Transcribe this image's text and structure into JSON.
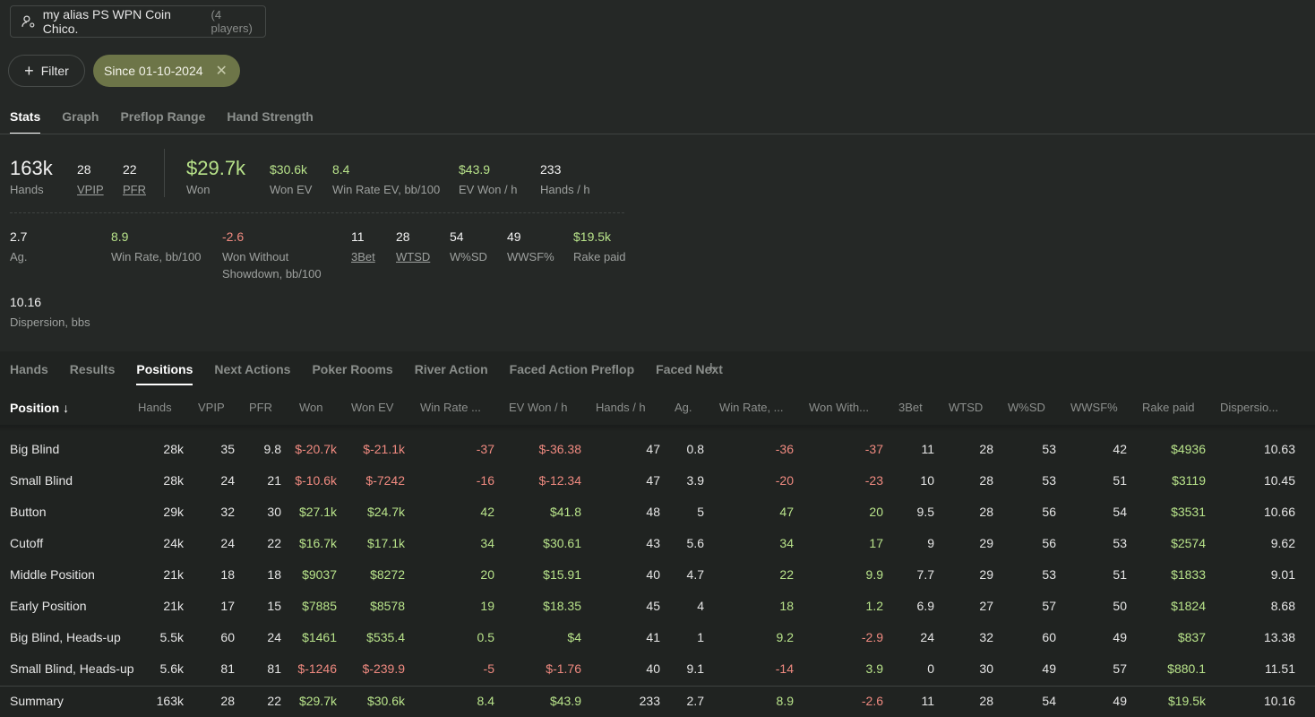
{
  "player": {
    "alias": "my alias PS WPN Coin Chico.",
    "count": "(4 players)"
  },
  "filter": {
    "label": "Filter",
    "since": "Since 01-10-2024"
  },
  "main_tabs": [
    "Stats",
    "Graph",
    "Preflop Range",
    "Hand Strength"
  ],
  "stats": {
    "hands": {
      "value": "163k",
      "label": "Hands"
    },
    "vpip": {
      "value": "28",
      "label": "VPIP"
    },
    "pfr": {
      "value": "22",
      "label": "PFR"
    },
    "won": {
      "value": "$29.7k",
      "label": "Won"
    },
    "won_ev": {
      "value": "$30.6k",
      "label": "Won EV"
    },
    "win_rate_ev": {
      "value": "8.4",
      "label": "Win Rate EV, bb/100"
    },
    "ev_won_h": {
      "value": "$43.9",
      "label": "EV Won / h"
    },
    "hands_h": {
      "value": "233",
      "label": "Hands / h"
    },
    "ag": {
      "value": "2.7",
      "label": "Ag."
    },
    "win_rate": {
      "value": "8.9",
      "label": "Win Rate, bb/100"
    },
    "wwsd": {
      "value": "-2.6",
      "label1": "Won Without",
      "label2": "Showdown, bb/100"
    },
    "threebet": {
      "value": "11",
      "label": "3Bet"
    },
    "wtsd": {
      "value": "28",
      "label": "WTSD"
    },
    "wsd": {
      "value": "54",
      "label": "W%SD"
    },
    "wwsf": {
      "value": "49",
      "label": "WWSF%"
    },
    "rake": {
      "value": "$19.5k",
      "label": "Rake paid"
    },
    "dispersion": {
      "value": "10.16",
      "label": "Dispersion, bbs"
    }
  },
  "sub_tabs": [
    "Hands",
    "Results",
    "Positions",
    "Next Actions",
    "Poker Rooms",
    "River Action",
    "Faced Action Preflop",
    "Faced Next"
  ],
  "table": {
    "headers": [
      "Position ↓",
      "Hands",
      "VPIP",
      "PFR",
      "Won",
      "Won EV",
      "Win Rate ...",
      "EV Won / h",
      "Hands / h",
      "Ag.",
      "Win Rate, ...",
      "Won With...",
      "3Bet",
      "WTSD",
      "W%SD",
      "WWSF%",
      "Rake paid",
      "Dispersio..."
    ],
    "rows": [
      [
        "Big Blind",
        "28k",
        "35",
        "9.8",
        "$-20.7k",
        "$-21.1k",
        "-37",
        "$-36.38",
        "47",
        "0.8",
        "-36",
        "-37",
        "11",
        "28",
        "53",
        "42",
        "$4936",
        "10.63"
      ],
      [
        "Small Blind",
        "28k",
        "24",
        "21",
        "$-10.6k",
        "$-7242",
        "-16",
        "$-12.34",
        "47",
        "3.9",
        "-20",
        "-23",
        "10",
        "28",
        "53",
        "51",
        "$3119",
        "10.45"
      ],
      [
        "Button",
        "29k",
        "32",
        "30",
        "$27.1k",
        "$24.7k",
        "42",
        "$41.8",
        "48",
        "5",
        "47",
        "20",
        "9.5",
        "28",
        "56",
        "54",
        "$3531",
        "10.66"
      ],
      [
        "Cutoff",
        "24k",
        "24",
        "22",
        "$16.7k",
        "$17.1k",
        "34",
        "$30.61",
        "43",
        "5.6",
        "34",
        "17",
        "9",
        "29",
        "56",
        "53",
        "$2574",
        "9.62"
      ],
      [
        "Middle Position",
        "21k",
        "18",
        "18",
        "$9037",
        "$8272",
        "20",
        "$15.91",
        "40",
        "4.7",
        "22",
        "9.9",
        "7.7",
        "29",
        "53",
        "51",
        "$1833",
        "9.01"
      ],
      [
        "Early Position",
        "21k",
        "17",
        "15",
        "$7885",
        "$8578",
        "19",
        "$18.35",
        "45",
        "4",
        "18",
        "1.2",
        "6.9",
        "27",
        "57",
        "50",
        "$1824",
        "8.68"
      ],
      [
        "Big Blind, Heads-up",
        "5.5k",
        "60",
        "24",
        "$1461",
        "$535.4",
        "0.5",
        "$4",
        "41",
        "1",
        "9.2",
        "-2.9",
        "24",
        "32",
        "60",
        "49",
        "$837",
        "13.38"
      ],
      [
        "Small Blind, Heads-up",
        "5.6k",
        "81",
        "81",
        "$-1246",
        "$-239.9",
        "-5",
        "$-1.76",
        "40",
        "9.1",
        "-14",
        "3.9",
        "0",
        "30",
        "49",
        "57",
        "$880.1",
        "11.51"
      ]
    ],
    "summary": [
      "Summary",
      "163k",
      "28",
      "22",
      "$29.7k",
      "$30.6k",
      "8.4",
      "$43.9",
      "233",
      "2.7",
      "8.9",
      "-2.6",
      "11",
      "28",
      "54",
      "49",
      "$19.5k",
      "10.16"
    ]
  },
  "colors": {
    "positive": "#b8e38a",
    "negative": "#f08a80",
    "accent_pill": "#6d7548"
  }
}
